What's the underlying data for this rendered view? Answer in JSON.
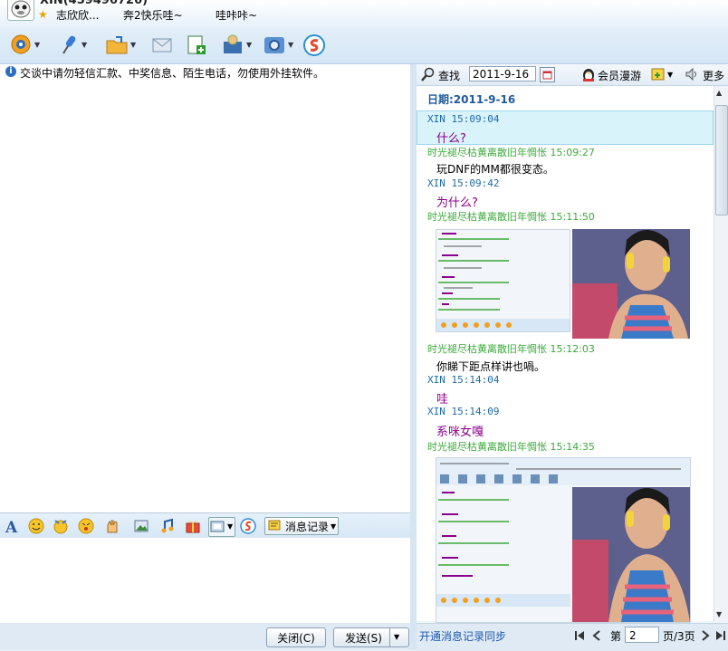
{
  "header": {
    "contact_name": "XIN(459496726)",
    "status_text": "志欣欣...",
    "signature_part1": "奔2快乐哇~",
    "signature_part2": "哇咔咔~"
  },
  "warning": "交谈中请勿轻信汇款、中奖信息、陌生电话，勿使用外挂软件。",
  "input_toolbar": {
    "message_record_label": "消息记录"
  },
  "buttons": {
    "close": "关闭(C)",
    "send": "发送(S)"
  },
  "right_toolbar": {
    "search_label": "查找",
    "date_value": "2011-9-16",
    "vip_label": "会员漫游",
    "more_label": "更多"
  },
  "history": {
    "date_heading": "日期:2011-9-16",
    "entries": [
      {
        "sender": "XIN 15:09:04",
        "text": "什么?"
      },
      {
        "sender": "时光褪尽枯黄离散旧年惆怅 15:09:27",
        "text": "玩DNF的MM都很变态。"
      },
      {
        "sender": "XIN 15:09:42",
        "text": "为什么?"
      },
      {
        "sender": "时光褪尽枯黄离散旧年惆怅 15:11:50",
        "text": ""
      },
      {
        "sender": "时光褪尽枯黄离散旧年惆怅 15:12:03",
        "text": "你睇下距点样讲也喎。"
      },
      {
        "sender": "XIN 15:14:04",
        "text": "哇"
      },
      {
        "sender": "XIN 15:14:09",
        "text": "系咪女嘎"
      },
      {
        "sender": "时光褪尽枯黄离散旧年惆怅 15:14:35",
        "text": ""
      }
    ]
  },
  "pager": {
    "sync_link": "开通消息记录同步",
    "page_prefix": "第",
    "page_value": "2",
    "page_suffix": "页/3页"
  },
  "colors": {
    "accent": "#1e6aa6",
    "other_sender": "#3aa93a",
    "purple_text": "#8b008b"
  }
}
